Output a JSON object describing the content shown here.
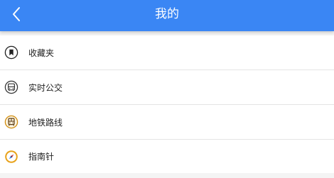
{
  "header": {
    "title": "我的",
    "back_icon": "chevron-left-icon"
  },
  "menu": {
    "items": [
      {
        "label": "收藏夹",
        "icon": "bookmark-icon"
      },
      {
        "label": "实时公交",
        "icon": "bus-icon"
      },
      {
        "label": "地铁路线",
        "icon": "subway-icon"
      },
      {
        "label": "指南针",
        "icon": "compass-icon"
      }
    ]
  },
  "colors": {
    "header_bg": "#3a86f4",
    "subway_accent": "#e8a21a",
    "compass_accent": "#e8a21a"
  }
}
